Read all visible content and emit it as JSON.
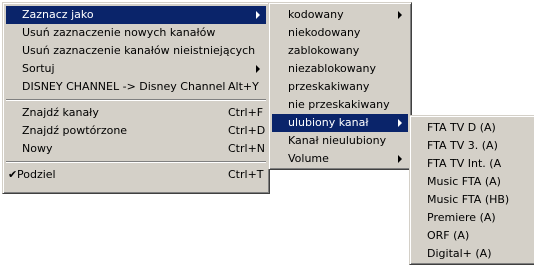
{
  "main_menu": {
    "items": [
      {
        "label": "Zaznacz jako",
        "shortcut": "",
        "submenu": true,
        "selected": true
      },
      {
        "label": "Usuń zaznaczenie nowych kanałów",
        "shortcut": ""
      },
      {
        "label": "Usuń zaznaczenie kanałów nieistniejących",
        "shortcut": ""
      },
      {
        "label": "Sortuj",
        "shortcut": "",
        "submenu": true
      },
      {
        "label": "DISNEY CHANNEL -> Disney Channel",
        "shortcut": "Alt+Y"
      },
      {
        "label": "Znajdź kanały",
        "shortcut": "Ctrl+F"
      },
      {
        "label": "Znajdź powtórzone",
        "shortcut": "Ctrl+D"
      },
      {
        "label": "Nowy",
        "shortcut": "Ctrl+N"
      },
      {
        "label": "Podziel",
        "shortcut": "Ctrl+T",
        "checked": true,
        "check_mark": "✔"
      }
    ]
  },
  "mark_as_submenu": {
    "items": [
      {
        "label": "kodowany",
        "submenu": true
      },
      {
        "label": "niekodowany"
      },
      {
        "label": "zablokowany"
      },
      {
        "label": "niezablokowany"
      },
      {
        "label": "przeskakiwany"
      },
      {
        "label": "nie przeskakiwany"
      },
      {
        "label": "ulubiony kanał",
        "submenu": true,
        "selected": true
      },
      {
        "label": "Kanał nieulubiony"
      },
      {
        "label": "Volume",
        "submenu": true
      }
    ]
  },
  "favorite_submenu": {
    "items": [
      {
        "label": "FTA TV D (A)"
      },
      {
        "label": "FTA TV 3. (A)"
      },
      {
        "label": "FTA TV Int. (A"
      },
      {
        "label": "Music FTA (A)"
      },
      {
        "label": "Music FTA (HB)"
      },
      {
        "label": "Premiere (A)"
      },
      {
        "label": "ORF (A)"
      },
      {
        "label": "Digital+ (A)"
      }
    ]
  },
  "colors": {
    "menu_bg": "#d4d0c8",
    "highlight": "#0a246a",
    "highlight_text": "#ffffff"
  }
}
